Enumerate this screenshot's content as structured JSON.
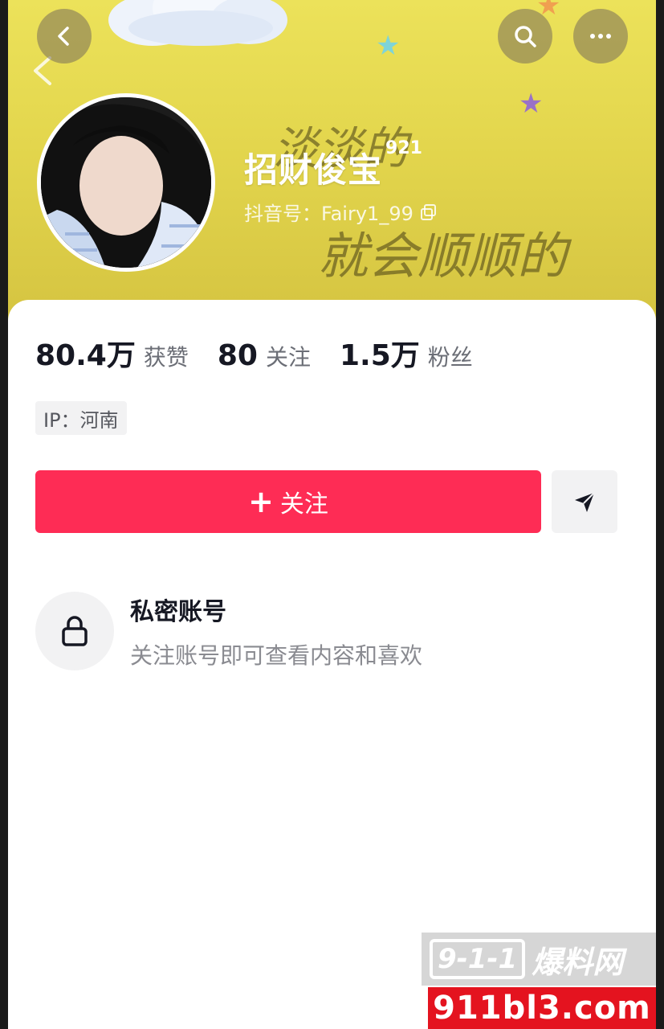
{
  "profile": {
    "name": "招财俊宝",
    "level": "921",
    "account_id": "抖音号：Fairy1_99",
    "banner_text_1": "淡淡的",
    "banner_text_2": "就会顺顺的"
  },
  "stats": [
    {
      "value": "80.4万",
      "label": "获赞"
    },
    {
      "value": "80",
      "label": "关注"
    },
    {
      "value": "1.5万",
      "label": "粉丝"
    }
  ],
  "ip": "IP：河南",
  "actions": {
    "follow_plus": "+",
    "follow_label": "关注"
  },
  "private": {
    "title": "私密账号",
    "subtitle": "关注账号即可查看内容和喜欢"
  },
  "watermark": {
    "box": "9-1-1",
    "cn": "爆料网",
    "domain": "911bl3.com"
  },
  "colors": {
    "accent": "#fe2c55",
    "banner": "#e3d64d"
  },
  "icons": [
    "back-icon",
    "search-icon",
    "more-icon",
    "copy-icon",
    "share-icon",
    "lock-icon"
  ]
}
